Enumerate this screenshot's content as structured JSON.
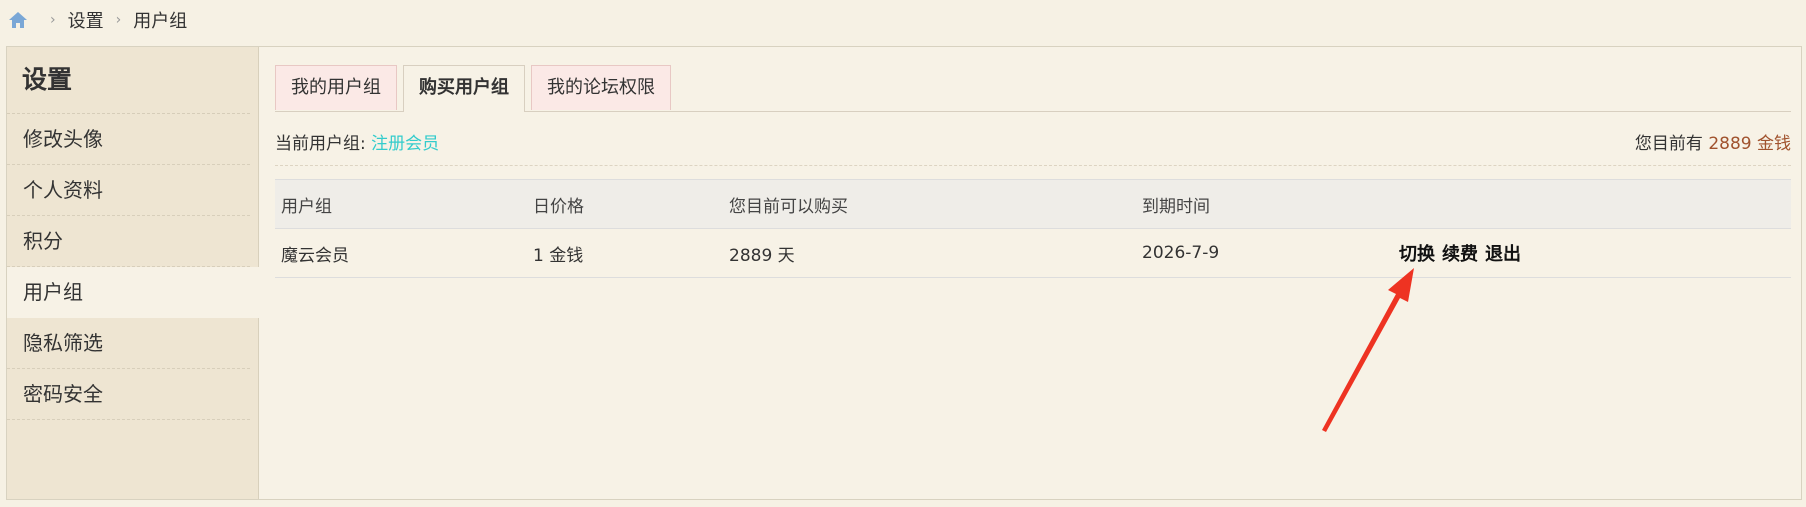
{
  "breadcrumb": {
    "items": [
      "设置",
      "用户组"
    ]
  },
  "sidebar": {
    "title": "设置",
    "items": [
      {
        "label": "修改头像"
      },
      {
        "label": "个人资料"
      },
      {
        "label": "积分"
      },
      {
        "label": "用户组"
      },
      {
        "label": "隐私筛选"
      },
      {
        "label": "密码安全"
      }
    ]
  },
  "tabs": [
    {
      "label": "我的用户组"
    },
    {
      "label": "购买用户组"
    },
    {
      "label": "我的论坛权限"
    }
  ],
  "current": {
    "prefix": "当前用户组:",
    "group": "注册会员",
    "money_prefix": "您目前有",
    "money_value": "2889 金钱"
  },
  "table": {
    "headers": [
      "用户组",
      "日价格",
      "您目前可以购买",
      "到期时间"
    ],
    "rows": [
      {
        "group": "魔云会员",
        "price": "1 金钱",
        "can_buy": "2889 天",
        "expires": "2026-7-9",
        "actions": [
          "切换",
          "续费",
          "退出"
        ]
      }
    ]
  },
  "colors": {
    "link_cyan": "#33cccc",
    "money_brown": "#a0522d",
    "arrow_red": "#ee3322"
  }
}
